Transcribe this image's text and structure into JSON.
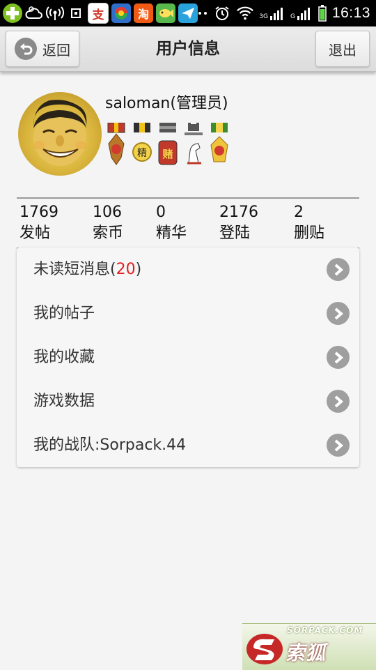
{
  "status_bar": {
    "time": "16:13",
    "app_icons": [
      "green-plus-app-icon",
      "cloud-weather-icon",
      "wifi-hotspot-icon",
      "screenshot-icon",
      "alipay-app-icon",
      "red-orange-app-icon",
      "taobao-app-icon",
      "fish-app-icon",
      "paper-plane-app-icon"
    ],
    "taobao_label": "淘",
    "alipay_label": "支",
    "network_label_1": "3G",
    "network_label_2": "G",
    "colors": {
      "alipay": "#d33a2f",
      "taobao": "#f05a14",
      "paper_plane": "#2aa3dc",
      "fish": "#5cb54a"
    }
  },
  "header": {
    "back_label": "返回",
    "title": "用户信息",
    "logout_label": "退出"
  },
  "profile": {
    "username": "saloman(管理员)",
    "medals": [
      "red-medal-icon",
      "gold-medal-icon",
      "gamble-medal-icon",
      "chess-knight-medal-icon",
      "yellow-medal-icon"
    ],
    "medal_text_1": "精",
    "medal_text_2": "赌"
  },
  "stats": [
    {
      "value": "1769",
      "label": "发帖"
    },
    {
      "value": "106",
      "label": "索币"
    },
    {
      "value": "0",
      "label": "精华"
    },
    {
      "value": "2176",
      "label": "登陆"
    },
    {
      "value": "2",
      "label": "删贴"
    }
  ],
  "menu": {
    "unread_prefix": "未读短消息(",
    "unread_count": "20",
    "unread_suffix": ")",
    "items": [
      {
        "label": "我的帖子"
      },
      {
        "label": "我的收藏"
      },
      {
        "label": "游戏数据"
      },
      {
        "label": "我的战队:Sorpack.44"
      }
    ]
  },
  "watermark": {
    "url": "SORPACK.COM",
    "name": "索狐"
  }
}
